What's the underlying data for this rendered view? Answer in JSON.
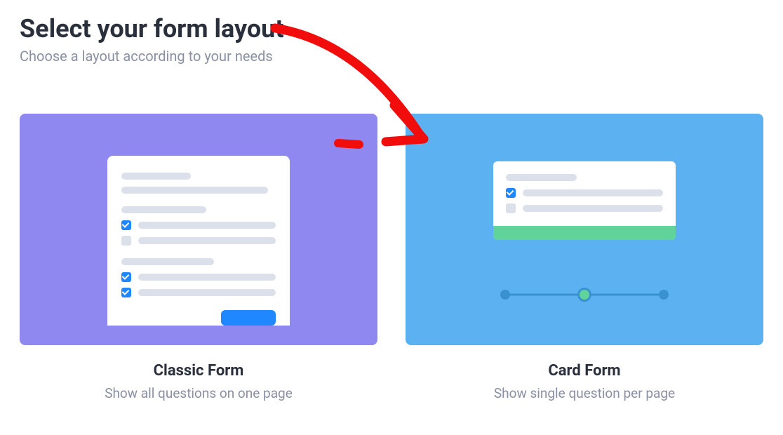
{
  "header": {
    "title": "Select your form layout",
    "subtitle": "Choose a layout according to your needs"
  },
  "options": {
    "classic": {
      "title": "Classic Form",
      "description": "Show all questions on one page"
    },
    "card": {
      "title": "Card Form",
      "description": "Show single question per page"
    }
  }
}
